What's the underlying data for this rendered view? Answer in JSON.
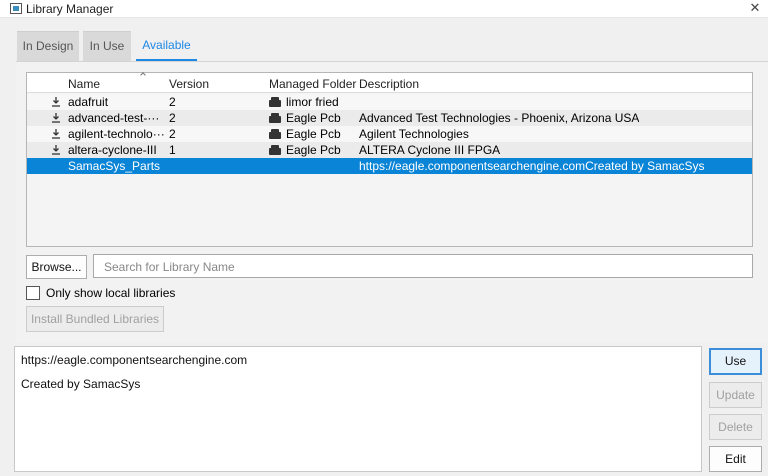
{
  "window": {
    "title": "Library Manager",
    "close_glyph": "✕"
  },
  "tabs": [
    {
      "label": "In Design",
      "active": false
    },
    {
      "label": "In Use",
      "active": false
    },
    {
      "label": "Available",
      "active": true
    }
  ],
  "table": {
    "columns": [
      "Name",
      "Version",
      "Managed Folder",
      "Description"
    ],
    "rows": [
      {
        "name": "adafruit",
        "version": "2",
        "folder": "limor fried",
        "description": "",
        "downloadable": true,
        "selected": false
      },
      {
        "name": "advanced-test-···",
        "version": "2",
        "folder": "Eagle Pcb",
        "description": "Advanced Test Technologies - Phoenix, Arizona USA",
        "downloadable": true,
        "selected": false
      },
      {
        "name": "agilent-technolo···",
        "version": "2",
        "folder": "Eagle Pcb",
        "description": "Agilent Technologies",
        "downloadable": true,
        "selected": false
      },
      {
        "name": "altera-cyclone-III",
        "version": "1",
        "folder": "Eagle Pcb",
        "description": "ALTERA Cyclone III FPGA",
        "downloadable": true,
        "selected": false
      },
      {
        "name": "SamacSys_Parts",
        "version": "",
        "folder": "",
        "description": "https://eagle.componentsearchengine.comCreated by SamacSys",
        "downloadable": false,
        "selected": true
      }
    ]
  },
  "browse_button": "Browse...",
  "search": {
    "placeholder": "Search for Library Name",
    "value": ""
  },
  "only_local": {
    "label": "Only show local libraries",
    "checked": false
  },
  "install_bundled_button": "Install Bundled Libraries",
  "details": {
    "url": "https://eagle.componentsearchengine.com",
    "description": "Created by SamacSys"
  },
  "actions": {
    "use": "Use",
    "update": "Update",
    "delete": "Delete",
    "edit": "Edit"
  },
  "icons": {
    "row_action": "download-icon",
    "folder": "briefcase-icon",
    "app": "library-manager-icon"
  },
  "colors": {
    "accent": "#1e88e5",
    "selection": "#0a84d6"
  }
}
